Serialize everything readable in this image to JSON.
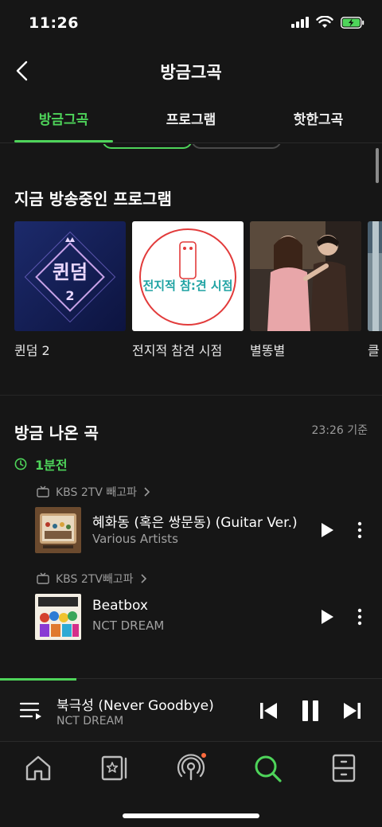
{
  "status": {
    "time": "11:26"
  },
  "header": {
    "title": "방금그곡"
  },
  "tabs": [
    {
      "label": "방금그곡"
    },
    {
      "label": "프로그램"
    },
    {
      "label": "핫한그곡"
    }
  ],
  "onair": {
    "title": "지금 방송중인 프로그램",
    "programs": [
      {
        "label": "퀸덤 2",
        "art_text": "퀸덤",
        "art_sub": "2"
      },
      {
        "label": "전지적 참견 시점",
        "art_text": "전지적 참:견 시점"
      },
      {
        "label": "별똥별"
      },
      {
        "label": "클"
      }
    ]
  },
  "recent": {
    "title": "방금 나온 곡",
    "basis": "23:26 기준",
    "ago": "1분전",
    "items": [
      {
        "source": "KBS 2TV 빼고파",
        "title": "혜화동 (혹은 쌍문동) (Guitar Ver.)",
        "artist": "Various Artists"
      },
      {
        "source": "KBS 2TV빼고파",
        "title": "Beatbox",
        "artist": "NCT DREAM"
      }
    ]
  },
  "player": {
    "title": "북극성 (Never Goodbye)",
    "artist": "NCT DREAM",
    "progress": 0.2
  },
  "bottom_nav": {
    "items": [
      {
        "icon": "home-icon"
      },
      {
        "icon": "library-icon"
      },
      {
        "icon": "podcast-icon",
        "badge": true
      },
      {
        "icon": "search-icon",
        "active": true
      },
      {
        "icon": "storage-icon"
      }
    ]
  },
  "colors": {
    "accent": "#4ed45a",
    "background": "#161616",
    "badge": "#ff6a3d"
  }
}
